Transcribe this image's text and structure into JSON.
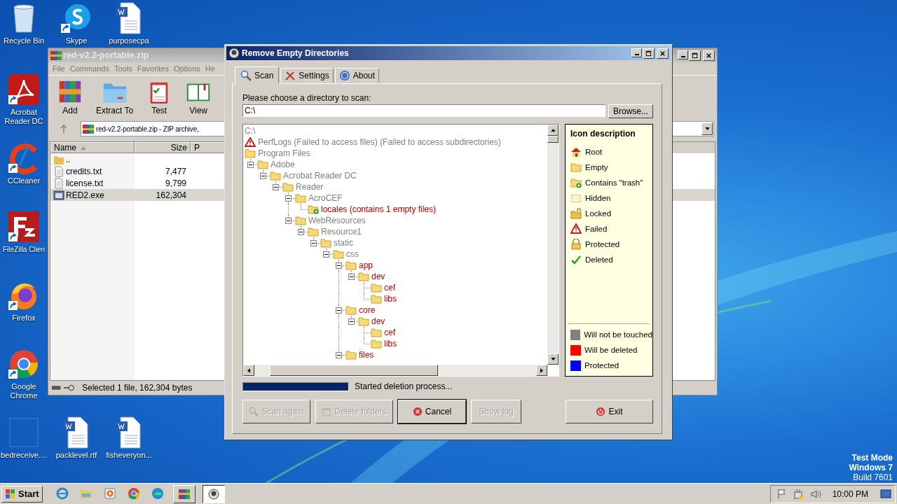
{
  "desktop_icons": [
    {
      "label": "Recycle Bin",
      "kind": "recycle"
    },
    {
      "label": "Skype",
      "kind": "skype"
    },
    {
      "label": "purposecpa",
      "kind": "word"
    },
    {
      "label": "Acrobat Reader DC",
      "kind": "acrobat"
    },
    {
      "label": "CCleaner",
      "kind": "ccleaner"
    },
    {
      "label": "FileZilla Clien",
      "kind": "filezilla"
    },
    {
      "label": "Firefox",
      "kind": "firefox"
    },
    {
      "label": "Google Chrome",
      "kind": "chrome"
    },
    {
      "label": "bedreceive....",
      "kind": "blank"
    },
    {
      "label": "packlevel.rtf",
      "kind": "word"
    },
    {
      "label": "fisheveryon...",
      "kind": "word"
    }
  ],
  "winrar": {
    "title": "red-v2.2-portable.zip",
    "menu": [
      "File",
      "Commands",
      "Tools",
      "Favorites",
      "Options",
      "He"
    ],
    "toolbar": [
      {
        "label": "Add",
        "kind": "add"
      },
      {
        "label": "Extract To",
        "kind": "extract"
      },
      {
        "label": "Test",
        "kind": "test"
      },
      {
        "label": "View",
        "kind": "view"
      }
    ],
    "address": "red-v2.2-portable.zip - ZIP archive,",
    "columns": [
      "Name",
      "Size",
      "P"
    ],
    "rows": [
      {
        "name": "..",
        "kind": "up",
        "selected": false
      },
      {
        "name": "credits.txt",
        "size": "7,477",
        "kind": "text",
        "selected": false
      },
      {
        "name": "license.txt",
        "size": "9,799",
        "kind": "text",
        "selected": false
      },
      {
        "name": "RED2.exe",
        "size": "162,304",
        "kind": "exe",
        "selected": true
      }
    ],
    "status": "Selected 1 file, 162,304 bytes"
  },
  "dialog": {
    "title": "Remove Empty Directories",
    "tabs": [
      {
        "label": "Scan",
        "kind": "scan",
        "selected": true
      },
      {
        "label": "Settings",
        "kind": "settings",
        "selected": false
      },
      {
        "label": "About",
        "kind": "about",
        "selected": false
      }
    ],
    "prompt": "Please choose a directory to scan:",
    "path": "C:\\",
    "browse": "Browse...",
    "tree": [
      {
        "label": "C:\\",
        "kind": "drive",
        "will_delete": false
      },
      {
        "label": "PerfLogs (Failed to access files) (Failed to access subdirectories)",
        "kind": "failed",
        "will_delete": false
      },
      {
        "label": "Program Files",
        "kind": "folder",
        "will_delete": false,
        "children": [
          {
            "label": "Adobe",
            "kind": "folder",
            "will_delete": false,
            "expanded": true,
            "children": [
              {
                "label": "Acrobat Reader DC",
                "kind": "folder",
                "will_delete": false,
                "expanded": true,
                "children": [
                  {
                    "label": "Reader",
                    "kind": "folder",
                    "will_delete": false,
                    "expanded": true,
                    "children": [
                      {
                        "label": "AcroCEF",
                        "kind": "folder",
                        "will_delete": false,
                        "expanded": true,
                        "children": [
                          {
                            "label": "locales (contains 1 empty files)",
                            "kind": "trash",
                            "will_delete": true
                          }
                        ]
                      },
                      {
                        "label": "WebResources",
                        "kind": "folder",
                        "will_delete": false,
                        "expanded": true,
                        "children": [
                          {
                            "label": "Resource1",
                            "kind": "folder",
                            "will_delete": false,
                            "expanded": true,
                            "children": [
                              {
                                "label": "static",
                                "kind": "folder",
                                "will_delete": false,
                                "expanded": true,
                                "children": [
                                  {
                                    "label": "css",
                                    "kind": "folder",
                                    "will_delete": false,
                                    "expanded": true,
                                    "children": [
                                      {
                                        "label": "app",
                                        "kind": "folder",
                                        "will_delete": true,
                                        "expanded": true,
                                        "children": [
                                          {
                                            "label": "dev",
                                            "kind": "folder",
                                            "will_delete": true,
                                            "expanded": true,
                                            "children": [
                                              {
                                                "label": "cef",
                                                "kind": "folder",
                                                "will_delete": true
                                              },
                                              {
                                                "label": "libs",
                                                "kind": "folder",
                                                "will_delete": true
                                              }
                                            ]
                                          }
                                        ]
                                      },
                                      {
                                        "label": "core",
                                        "kind": "folder",
                                        "will_delete": true,
                                        "expanded": true,
                                        "children": [
                                          {
                                            "label": "dev",
                                            "kind": "folder",
                                            "will_delete": true,
                                            "expanded": true,
                                            "children": [
                                              {
                                                "label": "cef",
                                                "kind": "folder",
                                                "will_delete": true
                                              },
                                              {
                                                "label": "libs",
                                                "kind": "folder",
                                                "will_delete": true
                                              }
                                            ]
                                          }
                                        ]
                                      },
                                      {
                                        "label": "files",
                                        "kind": "folder",
                                        "will_delete": true,
                                        "expanded": true
                                      }
                                    ]
                                  }
                                ]
                              }
                            ]
                          }
                        ]
                      }
                    ]
                  }
                ]
              }
            ]
          }
        ]
      }
    ],
    "legend": {
      "title": "Icon description",
      "icons": [
        {
          "label": "Root",
          "kind": "root"
        },
        {
          "label": "Empty",
          "kind": "folder"
        },
        {
          "label": "Contains \"trash\"",
          "kind": "trash"
        },
        {
          "label": "Hidden",
          "kind": "hidden"
        },
        {
          "label": "Locked",
          "kind": "locked"
        },
        {
          "label": "Failed",
          "kind": "failed"
        },
        {
          "label": "Protected",
          "kind": "protected"
        },
        {
          "label": "Deleted",
          "kind": "deleted"
        }
      ],
      "colors": [
        {
          "label": "Will not be touched",
          "color": "#808080"
        },
        {
          "label": "Will be deleted",
          "color": "#ff0000"
        },
        {
          "label": "Protected",
          "color": "#0000ff"
        }
      ]
    },
    "progress": {
      "level": 1,
      "status": "Started deletion process..."
    },
    "buttons": [
      {
        "label": "Scan again",
        "kind": "scan",
        "disabled": true
      },
      {
        "label": "Delete folders",
        "kind": "delete",
        "disabled": true
      },
      {
        "label": "Cancel",
        "kind": "cancel",
        "disabled": false
      },
      {
        "label": "Show log",
        "kind": "plain",
        "disabled": true
      },
      {
        "label": "Exit",
        "kind": "exit",
        "disabled": false
      }
    ]
  },
  "watermark_text": [
    "Test Mode",
    "Windows 7",
    "Build 7601"
  ],
  "taskbar": {
    "start": "Start",
    "apps": [
      {
        "kind": "ie",
        "selected": false
      },
      {
        "kind": "explorer",
        "selected": false
      },
      {
        "kind": "media",
        "selected": false
      },
      {
        "kind": "chrome",
        "selected": false
      },
      {
        "kind": "edge",
        "selected": false
      },
      {
        "kind": "winrar",
        "selected": false
      },
      {
        "kind": "red",
        "selected": true
      }
    ],
    "clock": "10:00 PM"
  }
}
